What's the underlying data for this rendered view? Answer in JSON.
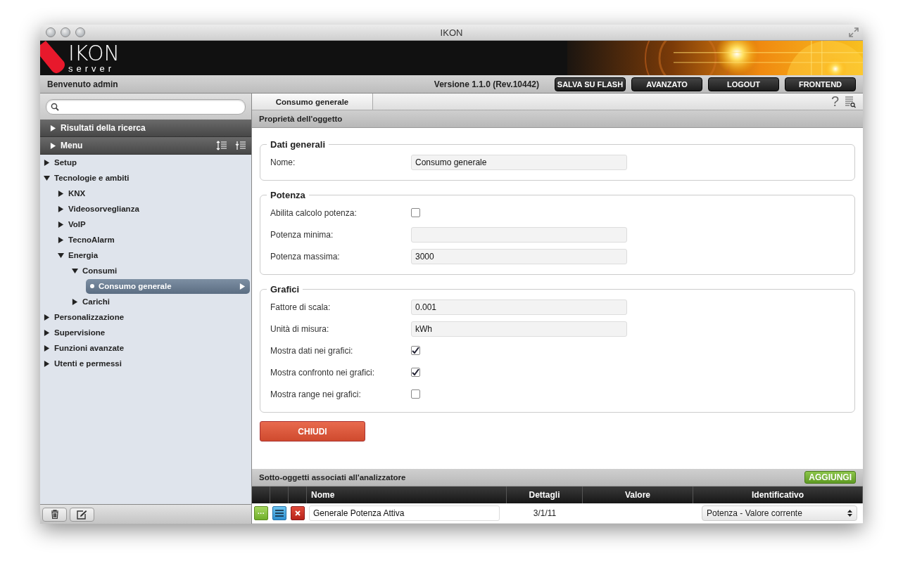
{
  "window": {
    "title": "IKON"
  },
  "logo": {
    "brand": "IKON",
    "tagline": "server"
  },
  "top_bar": {
    "welcome": "Benvenuto admin",
    "version": "Versione 1.1.0 (Rev.10442)",
    "buttons": [
      "SALVA SU FLASH",
      "AVANZATO",
      "LOGOUT",
      "FRONTEND"
    ]
  },
  "sidebar": {
    "sections": [
      {
        "label": "Risultati della ricerca",
        "expanded": false
      },
      {
        "label": "Menu",
        "expanded": false
      }
    ],
    "tree": [
      {
        "label": "Setup",
        "expanded": false,
        "selected": false
      },
      {
        "label": "Tecnologie e ambiti",
        "expanded": true,
        "selected": false,
        "children": [
          {
            "label": "KNX",
            "expanded": false,
            "selected": false
          },
          {
            "label": "Videosorveglianza",
            "expanded": false,
            "selected": false
          },
          {
            "label": "VoIP",
            "expanded": false,
            "selected": false
          },
          {
            "label": "TecnoAlarm",
            "expanded": false,
            "selected": false
          },
          {
            "label": "Energia",
            "expanded": true,
            "selected": false,
            "children": [
              {
                "label": "Consumi",
                "expanded": true,
                "selected": false,
                "children": [
                  {
                    "label": "Consumo generale",
                    "selected": true
                  }
                ]
              },
              {
                "label": "Carichi",
                "expanded": false,
                "selected": false
              }
            ]
          }
        ]
      },
      {
        "label": "Personalizzazione",
        "expanded": false,
        "selected": false
      },
      {
        "label": "Supervisione",
        "expanded": false,
        "selected": false
      },
      {
        "label": "Funzioni avanzate",
        "expanded": false,
        "selected": false
      },
      {
        "label": "Utenti e permessi",
        "expanded": false,
        "selected": false
      }
    ]
  },
  "tabs": [
    {
      "label": "Consumo generale",
      "selected": true
    }
  ],
  "tab_bar": {
    "help": "?"
  },
  "panel": {
    "title": "Proprietà dell'oggetto",
    "sections": [
      {
        "title": "Dati generali",
        "fields": [
          {
            "label": "Nome:",
            "kind": "text",
            "value": "Consumo generale"
          }
        ]
      },
      {
        "title": "Potenza",
        "fields": [
          {
            "label": "Abilita calcolo potenza:",
            "kind": "checkbox",
            "checked": false
          },
          {
            "label": "Potenza minima:",
            "kind": "text"
          },
          {
            "label": "Potenza massima:",
            "kind": "text",
            "value": "3000"
          }
        ]
      },
      {
        "title": "Grafici",
        "fields": [
          {
            "label": "Fattore di scala:",
            "kind": "text",
            "value": "0.001"
          },
          {
            "label": "Unità di misura:",
            "kind": "text",
            "value": "kWh"
          },
          {
            "label": "Mostra dati nei grafici:",
            "kind": "checkbox",
            "checked": true
          },
          {
            "label": "Mostra confronto nei grafici:",
            "kind": "checkbox",
            "checked": true
          },
          {
            "label": "Mostra range nei grafici:",
            "kind": "checkbox",
            "checked": false
          }
        ]
      }
    ],
    "close_button": "CHIUDI"
  },
  "subobjects": {
    "title": "Sotto-oggetti associati all'analizzatore",
    "add_button": "AGGIUNGI",
    "columns": [
      "Nome",
      "Dettagli",
      "Valore",
      "Identificativo"
    ],
    "rows": [
      {
        "more_button": "···",
        "name": "Generale Potenza Attiva",
        "details": "3/1/11",
        "identifier": "Potenza - Valore corrente"
      }
    ]
  }
}
